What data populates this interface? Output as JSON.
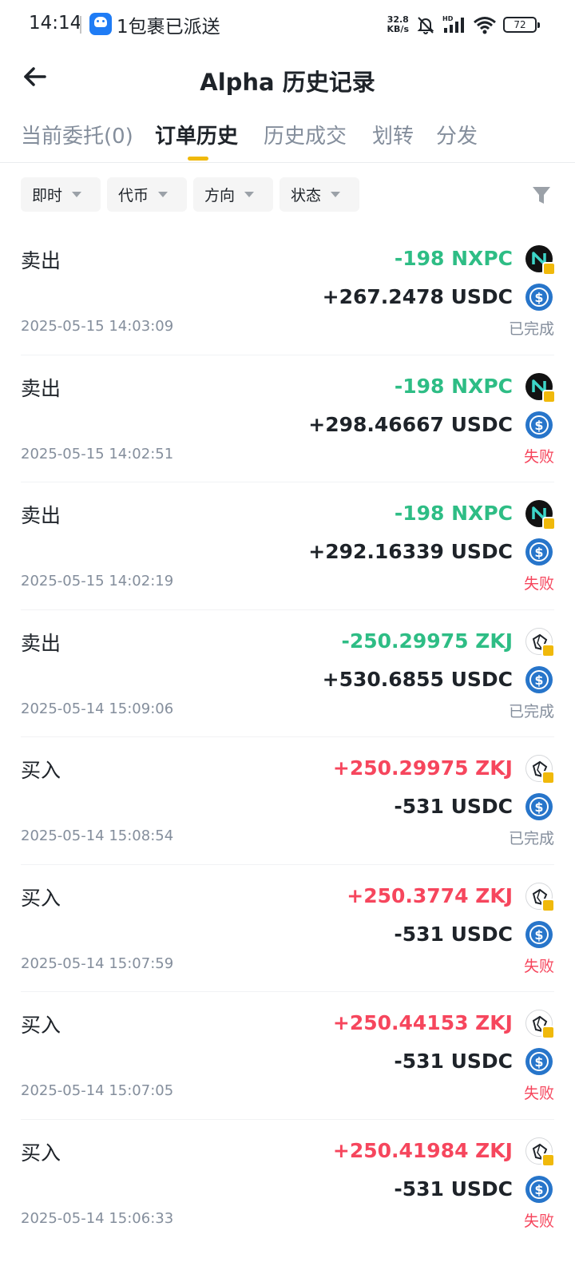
{
  "status_bar": {
    "time": "14:14",
    "notification_text": "1包裹已派送",
    "net_speed_value": "32.8",
    "net_speed_unit": "KB/s",
    "battery": "72"
  },
  "header": {
    "title": "Alpha 历史记录"
  },
  "tabs": [
    {
      "label": "当前委托(0)",
      "active": false
    },
    {
      "label": "订单历史",
      "active": true
    },
    {
      "label": "历史成交",
      "active": false
    },
    {
      "label": "划转",
      "active": false
    },
    {
      "label": "分发",
      "active": false
    }
  ],
  "filters": [
    {
      "label": "即时"
    },
    {
      "label": "代币"
    },
    {
      "label": "方向"
    },
    {
      "label": "状态"
    }
  ],
  "colors": {
    "up": "#f6465d",
    "down": "#2ebd85",
    "accent": "#f0b90b",
    "muted": "#848e9c"
  },
  "orders": [
    {
      "side": "卖出",
      "amount1": "-198 NXPC",
      "amount2": "+267.2478 USDC",
      "time": "2025-05-15 14:03:09",
      "status": "已完成"
    },
    {
      "side": "卖出",
      "amount1": "-198 NXPC",
      "amount2": "+298.46667 USDC",
      "time": "2025-05-15 14:02:51",
      "status": "失败"
    },
    {
      "side": "卖出",
      "amount1": "-198 NXPC",
      "amount2": "+292.16339 USDC",
      "time": "2025-05-15 14:02:19",
      "status": "失败"
    },
    {
      "side": "卖出",
      "amount1": "-250.29975 ZKJ",
      "amount2": "+530.6855 USDC",
      "time": "2025-05-14 15:09:06",
      "status": "已完成"
    },
    {
      "side": "买入",
      "amount1": "+250.29975 ZKJ",
      "amount2": "-531 USDC",
      "time": "2025-05-14 15:08:54",
      "status": "已完成"
    },
    {
      "side": "买入",
      "amount1": "+250.3774 ZKJ",
      "amount2": "-531 USDC",
      "time": "2025-05-14 15:07:59",
      "status": "失败"
    },
    {
      "side": "买入",
      "amount1": "+250.44153 ZKJ",
      "amount2": "-531 USDC",
      "time": "2025-05-14 15:07:05",
      "status": "失败"
    },
    {
      "side": "买入",
      "amount1": "+250.41984 ZKJ",
      "amount2": "-531 USDC",
      "time": "2025-05-14 15:06:33",
      "status": "失败"
    }
  ]
}
